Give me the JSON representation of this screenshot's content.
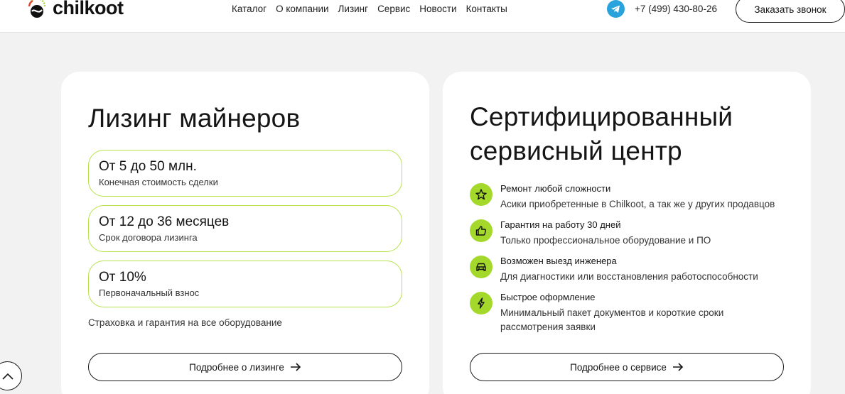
{
  "header": {
    "logo_text": "chilkoot",
    "nav": [
      "Каталог",
      "О компании",
      "Лизинг",
      "Сервис",
      "Новости",
      "Контакты"
    ],
    "phone": "+7 (499) 430-80-26",
    "call_button": "Заказать звонок"
  },
  "leasing": {
    "title": "Лизинг майнеров",
    "stats": [
      {
        "value": "От 5 до 50 млн.",
        "label": "Конечная стоимость сделки"
      },
      {
        "value": "От 12 до 36 месяцев",
        "label": "Срок договора лизинга"
      },
      {
        "value": "От 10%",
        "label": "Первоначальный взнос"
      }
    ],
    "note": "Страховка и гарантия на все оборудование",
    "more_button": "Подробнее о лизинге"
  },
  "service": {
    "title": "Сертифицированный сервисный центр",
    "features": [
      {
        "icon": "star-icon",
        "title": "Ремонт любой сложности",
        "desc": "Асики приобретенные в Chilkoot, а так же у других продавцов"
      },
      {
        "icon": "thumbs-up-icon",
        "title": "Гарантия на работу 30 дней",
        "desc": "Только профессиональное оборудование и ПО"
      },
      {
        "icon": "car-icon",
        "title": "Возможен выезд инженера",
        "desc": "Для диагностики или восстановления работоспособности"
      },
      {
        "icon": "lightning-icon",
        "title": "Быстрое оформление",
        "desc": "Минимальный пакет документов и короткие сроки рассмотрения заявки"
      }
    ],
    "more_button": "Подробнее о сервисе"
  },
  "colors": {
    "accent": "#a4d92c",
    "accent_border": "#b6e34a",
    "background": "#f2f2f2",
    "telegram": "#2aa3dd"
  }
}
